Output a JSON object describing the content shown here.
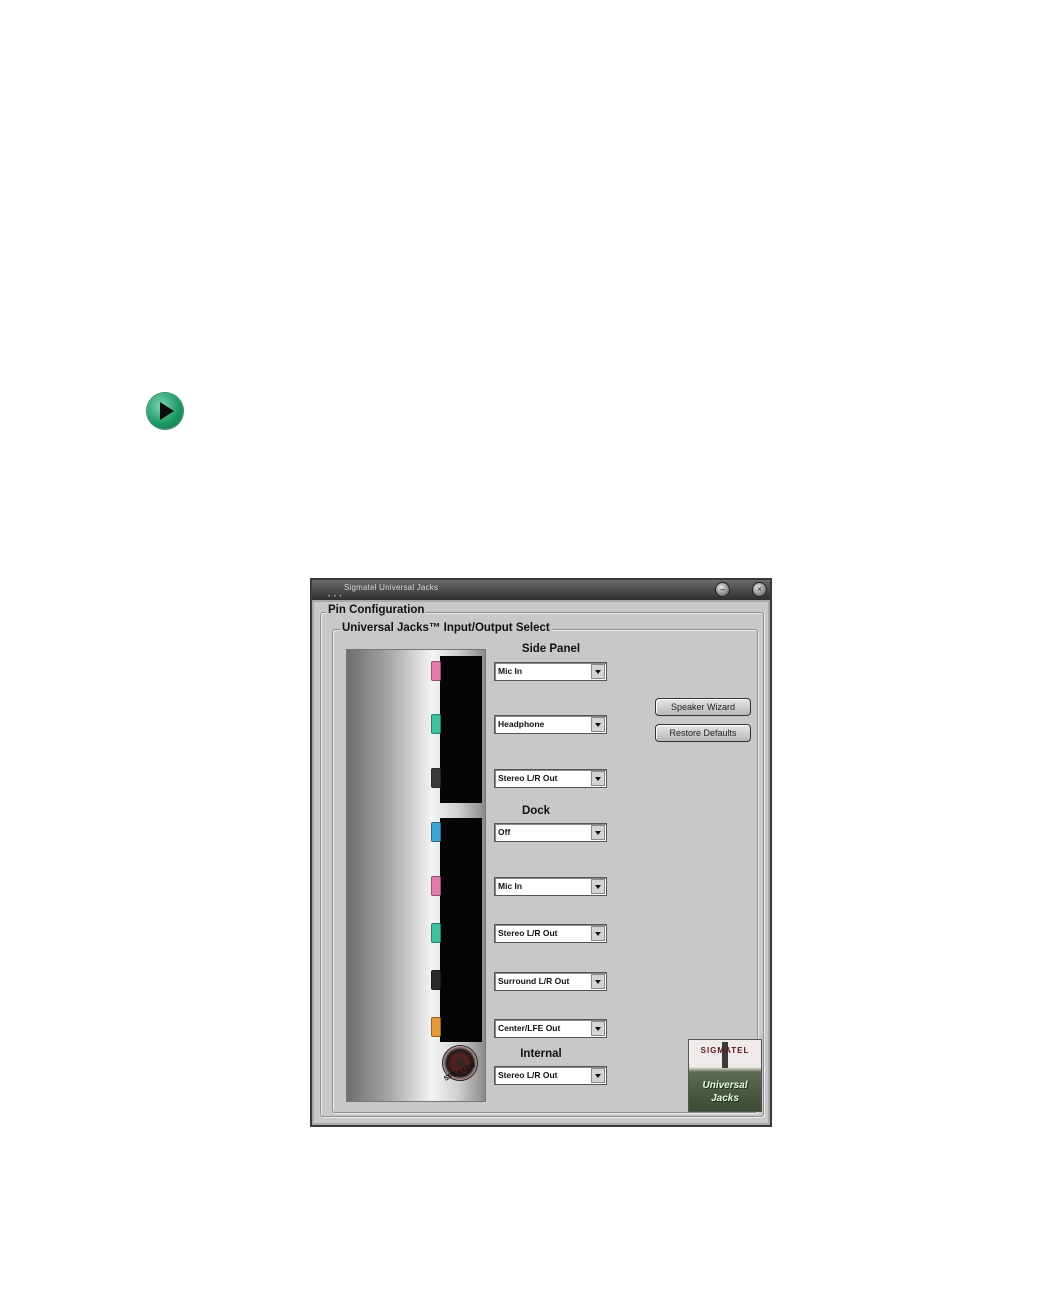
{
  "window": {
    "title": "Sigmatel Universal Jacks",
    "minimize_glyph": "–",
    "close_glyph": "×"
  },
  "pin_configuration": {
    "group_title": "Pin Configuration",
    "io_group_title": "Universal Jacks™ Input/Output Select",
    "speaker_label": "SPEAKER",
    "sections": {
      "side_panel": "Side Panel",
      "dock": "Dock",
      "internal": "Internal"
    },
    "side_panel": [
      {
        "value": "Mic In",
        "jack_color": "#e27aac"
      },
      {
        "value": "Headphone",
        "jack_color": "#3fc2a2"
      },
      {
        "value": "Stereo L/R Out",
        "jack_color": "#3a3a3a"
      }
    ],
    "dock": [
      {
        "value": "Off",
        "jack_color": "#3aa6d6"
      },
      {
        "value": "Mic In",
        "jack_color": "#e27aac"
      },
      {
        "value": "Stereo L/R Out",
        "jack_color": "#3fc2a2"
      },
      {
        "value": "Surround L/R Out",
        "jack_color": "#2a2a2a"
      },
      {
        "value": "Center/LFE Out",
        "jack_color": "#e59a3a"
      }
    ],
    "internal": [
      {
        "value": "Stereo L/R Out"
      }
    ]
  },
  "buttons": {
    "speaker_wizard": "Speaker Wizard",
    "restore_defaults": "Restore Defaults"
  },
  "logo": {
    "top_text": "SIGMATEL",
    "line1": "Universal",
    "line2": "Jacks"
  },
  "icons": {
    "page_arrow": "play-arrow-icon"
  }
}
